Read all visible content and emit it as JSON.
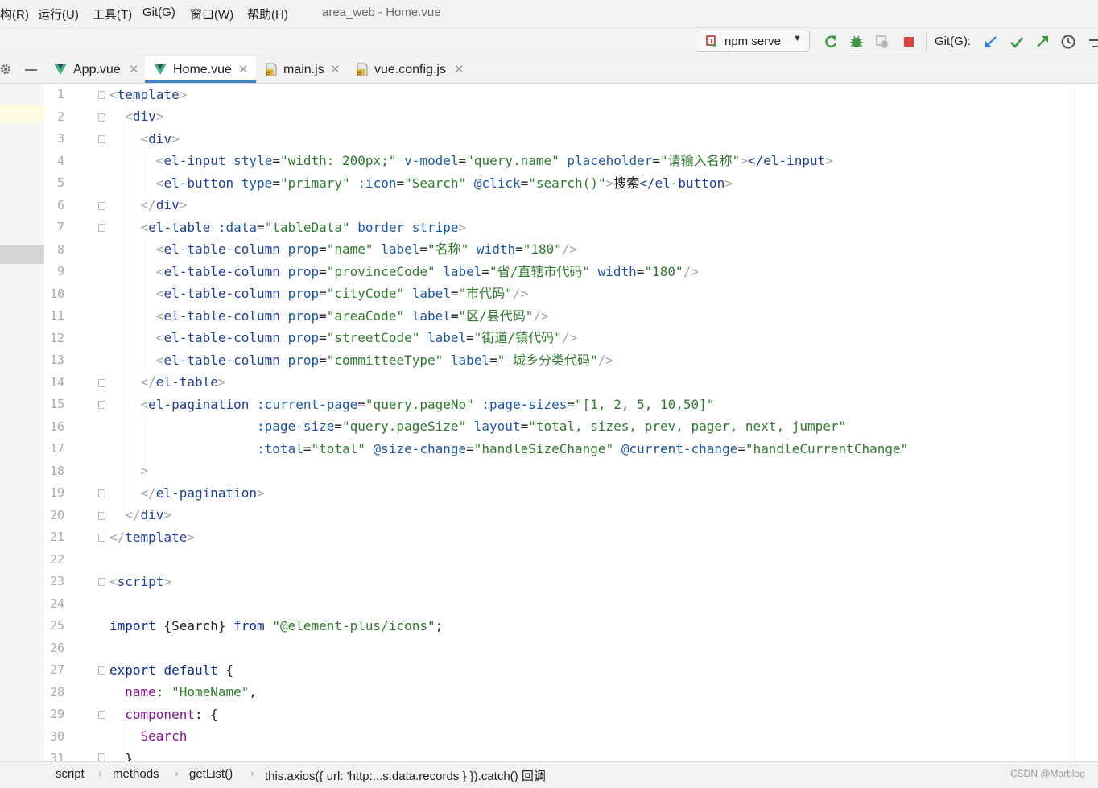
{
  "menubar": {
    "items": [
      "构(R)",
      "运行(U)",
      "工具(T)",
      "Git(G)",
      "窗口(W)",
      "帮助(H)"
    ],
    "window_title": "area_web - Home.vue"
  },
  "toolbar": {
    "run_config": "npm serve",
    "git_label": "Git(G):"
  },
  "tabs": [
    {
      "label": "App.vue",
      "icon": "vue-icon",
      "active": false
    },
    {
      "label": "Home.vue",
      "icon": "vue-icon",
      "active": true
    },
    {
      "label": "main.js",
      "icon": "js-file-icon",
      "active": false
    },
    {
      "label": "vue.config.js",
      "icon": "js-file-icon",
      "active": false
    }
  ],
  "code": {
    "line_numbers": [
      "1",
      "2",
      "3",
      "4",
      "5",
      "6",
      "7",
      "8",
      "9",
      "10",
      "11",
      "12",
      "13",
      "14",
      "15",
      "16",
      "17",
      "18",
      "19",
      "20",
      "21",
      "22",
      "23",
      "24",
      "25",
      "26",
      "27",
      "28",
      "29",
      "30",
      "31"
    ],
    "l1": {
      "tag": "template"
    },
    "l2": {
      "tag": "div"
    },
    "l3": {
      "tag": "div"
    },
    "l4": {
      "tag": "el-input",
      "a1": "style",
      "v1": "\"width: 200px;\"",
      "a2": "v-model",
      "v2": "\"query.name\"",
      "a3": "placeholder",
      "v3": "\"请输入名称\"",
      "close": "</el-input"
    },
    "l5": {
      "tag": "el-button",
      "a1": "type",
      "v1": "\"primary\"",
      "a2": ":icon",
      "v2": "\"Search\"",
      "a3": "@click",
      "v3": "\"search()\"",
      "text": "搜索",
      "close": "</el-button"
    },
    "l6": {
      "tag": "div"
    },
    "l7": {
      "tag": "el-table",
      "a1": ":data",
      "v1": "\"tableData\"",
      "a2": "border",
      "a3": "stripe"
    },
    "l8": {
      "tag": "el-table-column",
      "a1": "prop",
      "v1": "\"name\"",
      "a2": "label",
      "v2": "\"名称\"",
      "a3": "width",
      "v3": "\"180\""
    },
    "l9": {
      "tag": "el-table-column",
      "a1": "prop",
      "v1": "\"provinceCode\"",
      "a2": "label",
      "v2": "\"省/直辖市代码\"",
      "a3": "width",
      "v3": "\"180\""
    },
    "l10": {
      "tag": "el-table-column",
      "a1": "prop",
      "v1": "\"cityCode\"",
      "a2": "label",
      "v2": "\"市代码\""
    },
    "l11": {
      "tag": "el-table-column",
      "a1": "prop",
      "v1": "\"areaCode\"",
      "a2": "label",
      "v2": "\"区/县代码\""
    },
    "l12": {
      "tag": "el-table-column",
      "a1": "prop",
      "v1": "\"streetCode\"",
      "a2": "label",
      "v2": "\"街道/镇代码\""
    },
    "l13": {
      "tag": "el-table-column",
      "a1": "prop",
      "v1": "\"committeeType\"",
      "a2": "label",
      "v2": "\" 城乡分类代码\""
    },
    "l14": {
      "tag": "el-table"
    },
    "l15": {
      "tag": "el-pagination",
      "a1": ":current-page",
      "v1": "\"query.pageNo\"",
      "a2": ":page-sizes",
      "v2": "\"[1, 2, 5, 10,50]\""
    },
    "l16": {
      "a1": ":page-size",
      "v1": "\"query.pageSize\"",
      "a2": "layout",
      "v2": "\"total, sizes, prev, pager, next, jumper\""
    },
    "l17": {
      "a1": ":total",
      "v1": "\"total\"",
      "a2": "@size-change",
      "v2": "\"handleSizeChange\"",
      "a3": "@current-change",
      "v3": "\"handleCurrentChange\""
    },
    "l18": {
      "text": ">"
    },
    "l19": {
      "tag": "el-pagination"
    },
    "l20": {
      "tag": "div"
    },
    "l21": {
      "tag": "template"
    },
    "l23": {
      "tag": "script"
    },
    "l25": {
      "kw1": "import",
      "name": "{Search}",
      "kw2": "from",
      "str": "\"@element-plus/icons\"",
      "end": ";"
    },
    "l27": {
      "kw1": "export",
      "kw2": "default",
      "brace": "{"
    },
    "l28": {
      "prop": "name",
      "str": "\"HomeName\"",
      "end": ","
    },
    "l29": {
      "prop": "component",
      "end": ": {"
    },
    "l30": {
      "text": "Search"
    },
    "l31": {
      "text": "}"
    }
  },
  "statusbar": {
    "breadcrumbs": [
      "script",
      "methods",
      "getList()",
      "this.axios({ url: 'http:...s.data.records } }).catch() 回调"
    ]
  },
  "watermark": "CSDN @Marblog",
  "colors": {
    "tag": "#1d3e9a",
    "string": "#2d7a2d",
    "keyword": "#0b2b9c",
    "active_tab": "#4083c9"
  }
}
